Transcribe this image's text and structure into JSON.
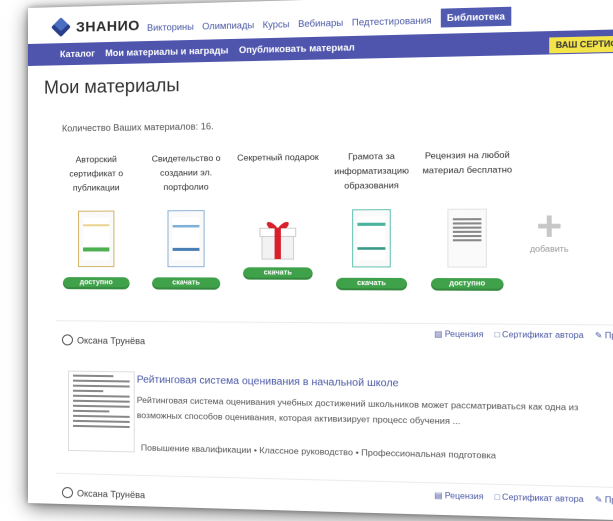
{
  "header": {
    "logo_text": "ЗНАНИО",
    "nav": [
      "Викторины",
      "Олимпиады",
      "Курсы",
      "Вебинары",
      "Педтестирования"
    ],
    "active_tab": "Библиотека"
  },
  "subnav": {
    "items": [
      "Каталог",
      "Мои материалы и награды",
      "Опубликовать материал"
    ],
    "badge": "ВАШ СЕРТИФИКАТ"
  },
  "page": {
    "title": "Мои материалы",
    "count_text": "Количество Ваших материалов: 16."
  },
  "materials": [
    {
      "title": "Авторский сертификат о публикации",
      "button": "доступно",
      "icon": "certificate-icon"
    },
    {
      "title": "Свидетельство о создании эл. портфолио",
      "button": "скачать",
      "icon": "portfolio-certificate-icon"
    },
    {
      "title": "Секретный подарок",
      "button": "скачать",
      "icon": "gift-icon"
    },
    {
      "title": "Грамота за информатизацию образования",
      "button": "скачать",
      "icon": "diploma-icon"
    },
    {
      "title": "Рецензия на любой материал бесплатно",
      "button": "доступно",
      "icon": "review-icon"
    }
  ],
  "add_label": "добавить",
  "entries": [
    {
      "author": "Оксана Трунёва",
      "actions": [
        "Рецензия",
        "Сертификат автора",
        "Править"
      ],
      "title": "Рейтинговая система оценивания в начальной школе",
      "description": "Рейтинговая система оценивания учебных достижений школьников может рассматриваться как одна из возможных способов оценивания, которая активизирует процесс обучения ...",
      "tags": "Повышение квалификации • Классное руководство • Профессиональная подготовка"
    },
    {
      "author": "Оксана Трунёва",
      "actions": [
        "Рецензия",
        "Сертификат автора",
        "Править"
      ]
    }
  ]
}
